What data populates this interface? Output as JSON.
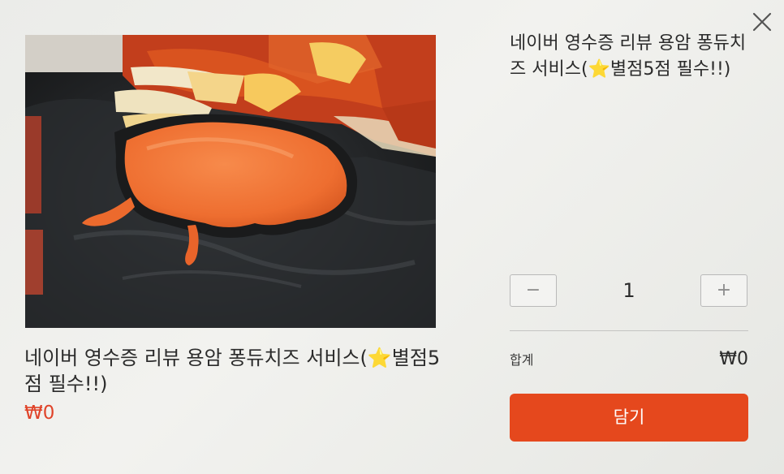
{
  "dialog": {
    "close_icon": "close-icon",
    "image_alt": "용암 퐁듀치즈",
    "product_name": "네이버 영수증 리뷰 용암 퐁듀치즈 서비스(⭐별점5점 필수!!)",
    "price": "₩0",
    "quantity": {
      "minus_label": "−",
      "value": "1",
      "plus_label": "+"
    },
    "total": {
      "label": "합계",
      "value": "₩0"
    },
    "add_button_label": "담기",
    "accent_color": "#e5481d",
    "price_color": "#e0442a"
  }
}
